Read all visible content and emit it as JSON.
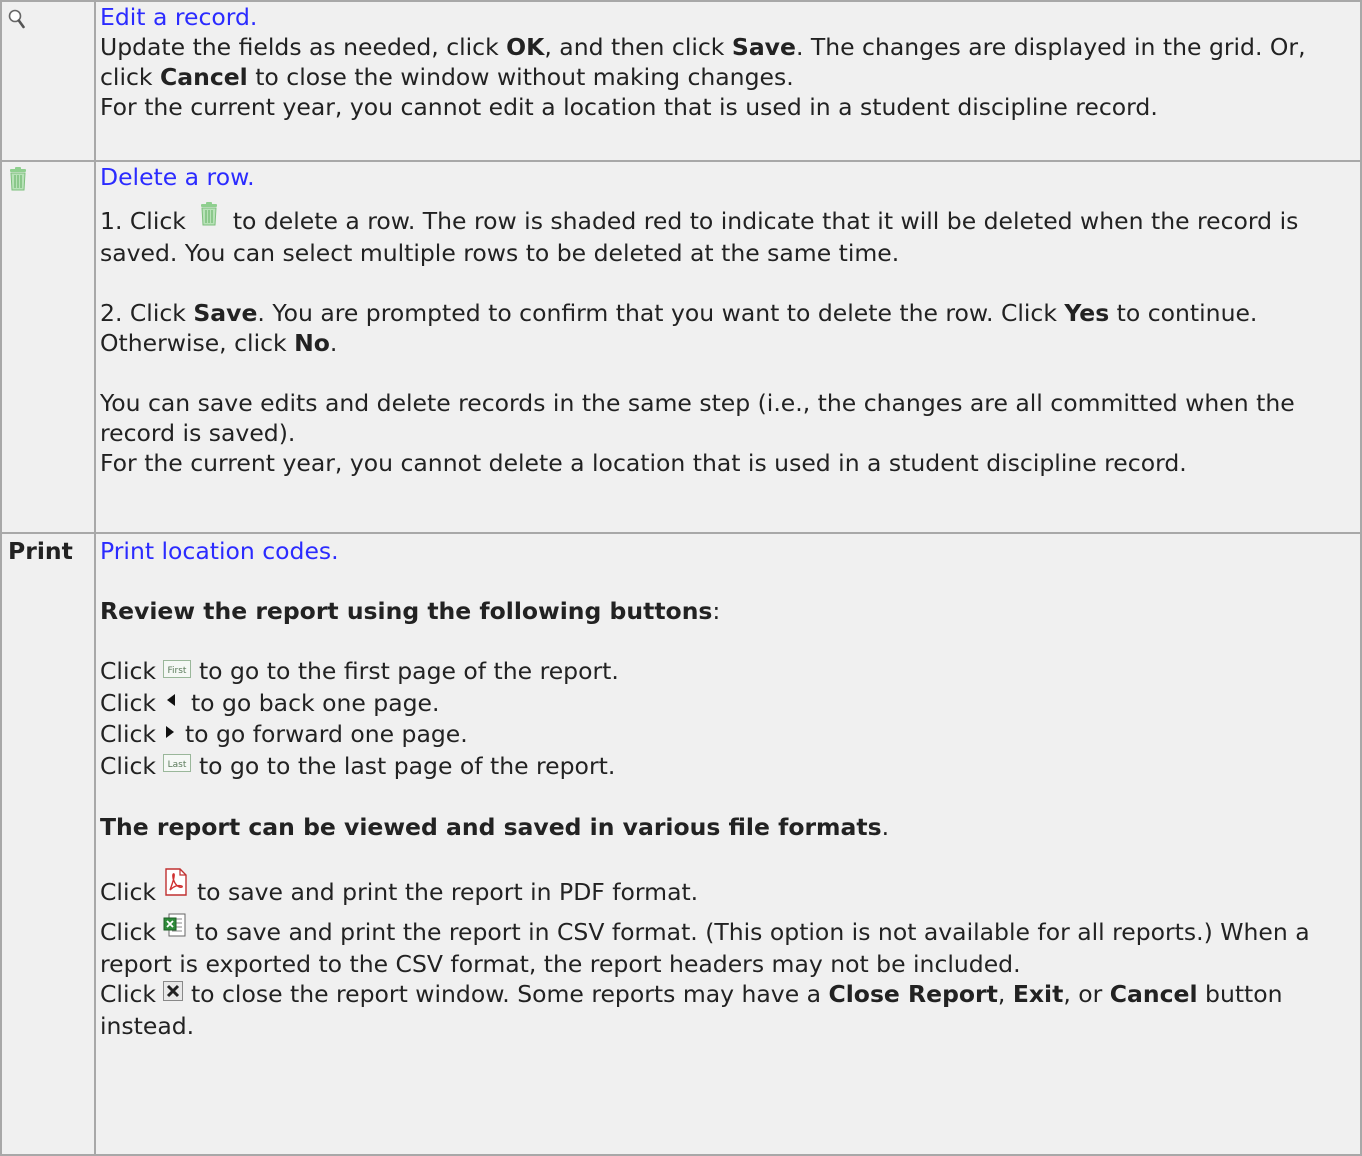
{
  "rows": [
    {
      "key_icon": "magnifier-icon",
      "link": "Edit a record.",
      "p1_a": "Update the fields as needed, click ",
      "p1_b": "OK",
      "p1_c": ", and then click ",
      "p1_d": "Save",
      "p1_e": ". The changes are displayed in the grid. Or, click ",
      "p1_f": "Cancel",
      "p1_g": " to close the window without making changes.",
      "p2": "For the current year, you cannot edit a location that is used in a student discipline record."
    },
    {
      "key_icon": "trash-icon",
      "link": "Delete a row.",
      "s1_a": "1. Click ",
      "s1_b": " to delete a row. The row is shaded red to indicate that it will be deleted when the record is saved. You can select multiple rows to be deleted at the same time.",
      "s2_a": "2. Click ",
      "s2_b": "Save",
      "s2_c": ". You are prompted to confirm that you want to delete the row. Click ",
      "s2_d": "Yes",
      "s2_e": " to continue. Otherwise, click ",
      "s2_f": "No",
      "s2_g": ".",
      "p3": "You can save edits and delete records in the same step (i.e., the changes are all committed when the record is saved).",
      "p4": "For the current year, you cannot delete a location that is used in a student discipline record."
    },
    {
      "key": "Print",
      "link": "Print location codes.",
      "h1": "Review the report using the following buttons",
      "h1_suffix": ":",
      "click": "Click ",
      "first": " to go to the first page of the report.",
      "back": " to go back one page.",
      "fwd": " to go forward one page.",
      "last": " to go to the last page of the report.",
      "h2": "The report can be viewed and saved in various file formats",
      "h2_suffix": ".",
      "pdf": " to save and print the report in PDF format.",
      "csv": " to save and print the report in CSV format. (This option is not available for all reports.) When a report is exported to the CSV format, the report headers may not be included.",
      "close_a": " to close the report window. Some reports may have a ",
      "close_b": "Close Report",
      "close_c": ", ",
      "close_d": "Exit",
      "close_e": ", or ",
      "close_f": "Cancel",
      "close_g": " button instead.",
      "first_btn": "First",
      "last_btn": "Last"
    }
  ]
}
